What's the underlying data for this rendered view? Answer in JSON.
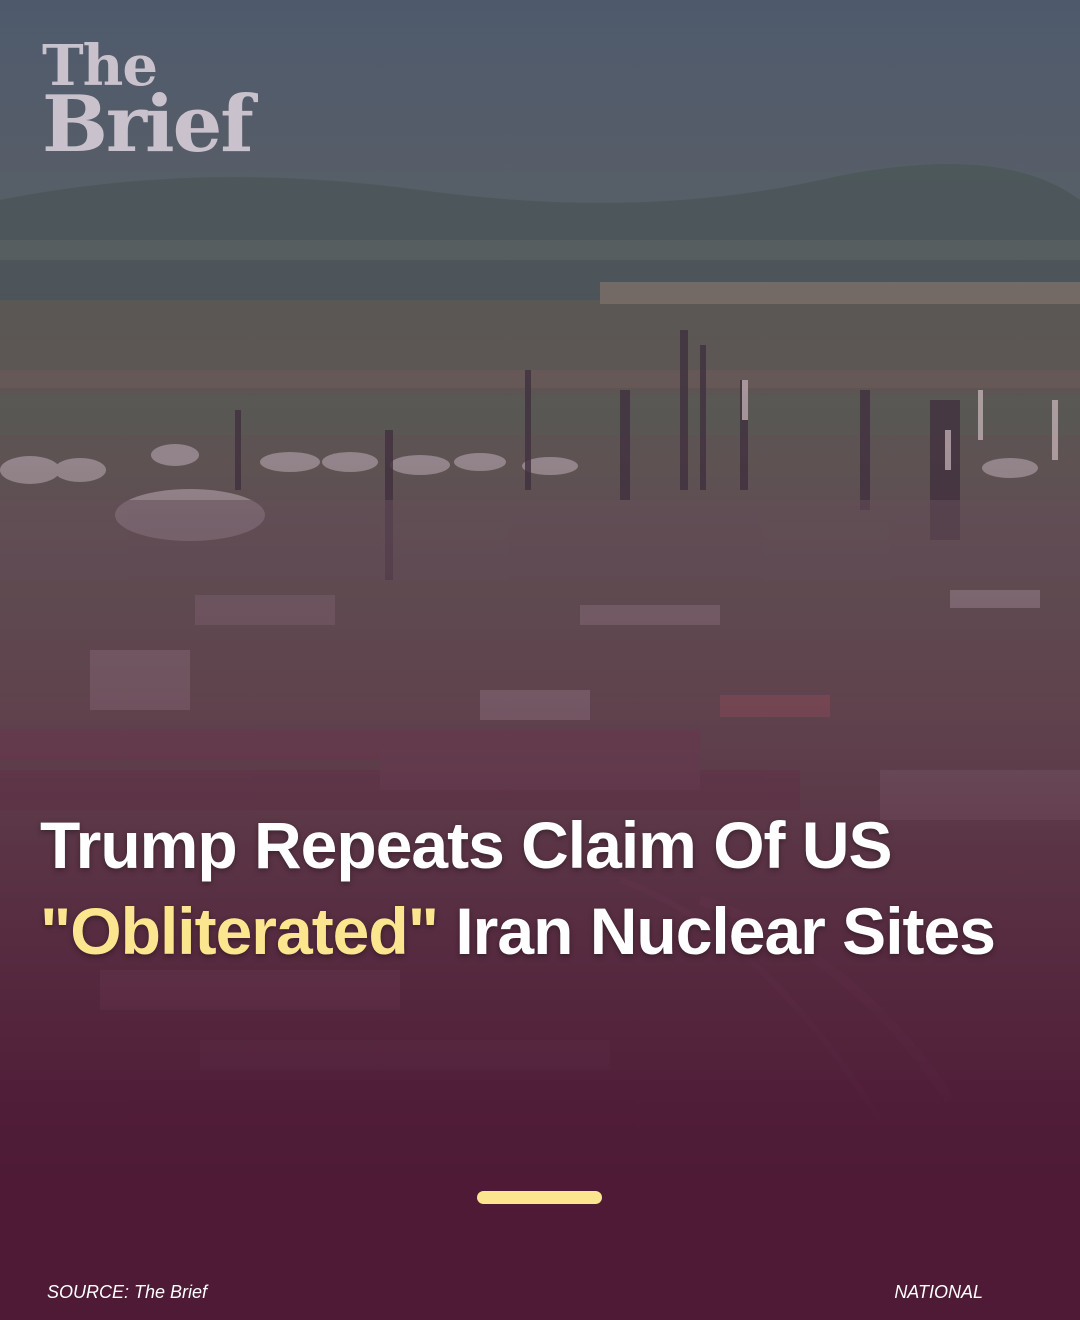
{
  "brand": {
    "logo_line1": "The",
    "logo_line2": "Brief"
  },
  "headline": {
    "part1": "Trump Repeats Claim Of US",
    "highlight": "\"Obliterated\"",
    "part2": "Iran Nuclear Sites"
  },
  "footer": {
    "source": "SOURCE: The Brief",
    "category": "NATIONAL"
  },
  "colors": {
    "background": "#4e1a36",
    "accent": "#fbe68f",
    "text": "#ffffff"
  }
}
